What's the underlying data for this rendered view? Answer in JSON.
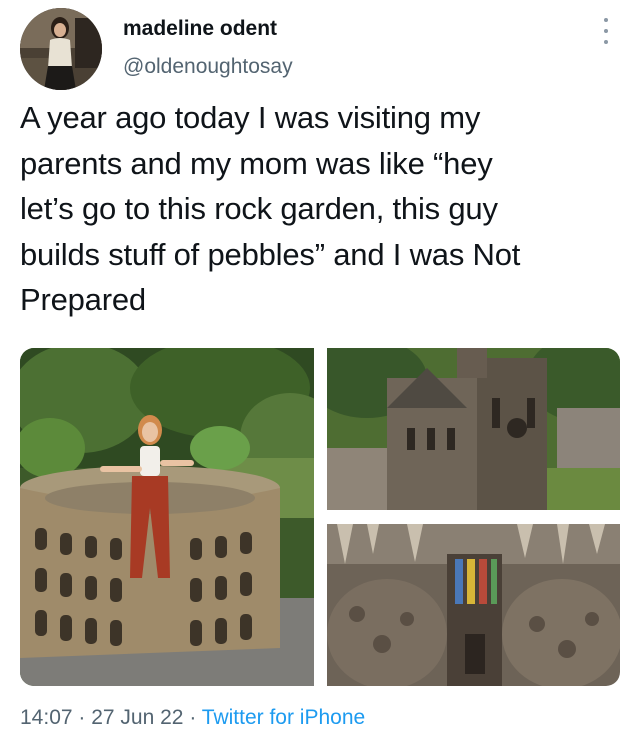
{
  "author": {
    "display_name": "madeline odent",
    "handle": "@oldenoughtosay",
    "avatar_icon": "profile-photo-woman"
  },
  "tweet": {
    "text": "A year ago today I was visiting my\nparents and my mom was like “hey\nlet’s go to this rock garden, this guy\nbuilds stuff of pebbles” and I was Not\nPrepared"
  },
  "media": [
    {
      "subject": "woman standing inside pebble colosseum replica"
    },
    {
      "subject": "pebble cathedral model in garden"
    },
    {
      "subject": "pebble interior with stained glass"
    }
  ],
  "footer": {
    "time": "14:07",
    "separator": " · ",
    "date": "27 Jun 22",
    "source": "Twitter for iPhone"
  },
  "colors": {
    "text": "#0f1419",
    "secondary": "#536471",
    "link": "#1d9bf0"
  },
  "icons": {
    "more": "more-vertical-icon"
  }
}
